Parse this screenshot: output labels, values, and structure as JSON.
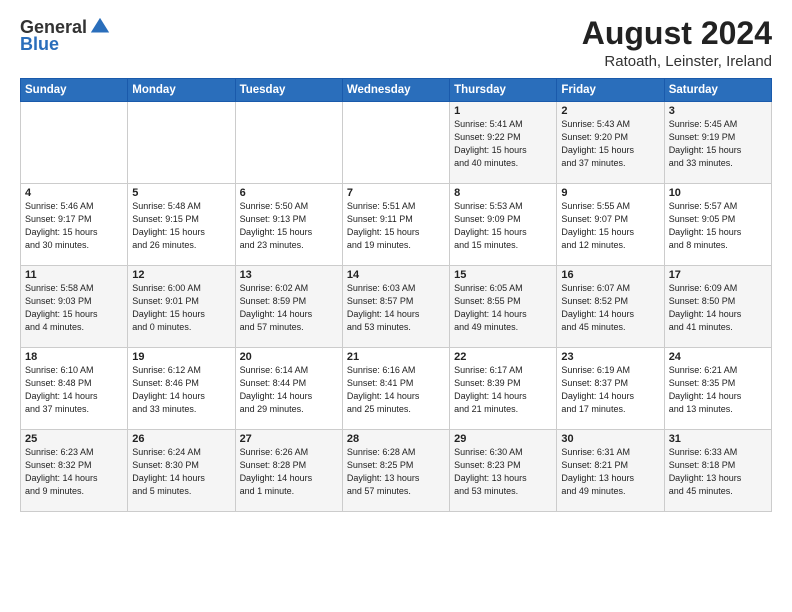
{
  "logo": {
    "general": "General",
    "blue": "Blue"
  },
  "title": "August 2024",
  "subtitle": "Ratoath, Leinster, Ireland",
  "weekdays": [
    "Sunday",
    "Monday",
    "Tuesday",
    "Wednesday",
    "Thursday",
    "Friday",
    "Saturday"
  ],
  "weeks": [
    [
      {
        "day": "",
        "info": ""
      },
      {
        "day": "",
        "info": ""
      },
      {
        "day": "",
        "info": ""
      },
      {
        "day": "",
        "info": ""
      },
      {
        "day": "1",
        "info": "Sunrise: 5:41 AM\nSunset: 9:22 PM\nDaylight: 15 hours\nand 40 minutes."
      },
      {
        "day": "2",
        "info": "Sunrise: 5:43 AM\nSunset: 9:20 PM\nDaylight: 15 hours\nand 37 minutes."
      },
      {
        "day": "3",
        "info": "Sunrise: 5:45 AM\nSunset: 9:19 PM\nDaylight: 15 hours\nand 33 minutes."
      }
    ],
    [
      {
        "day": "4",
        "info": "Sunrise: 5:46 AM\nSunset: 9:17 PM\nDaylight: 15 hours\nand 30 minutes."
      },
      {
        "day": "5",
        "info": "Sunrise: 5:48 AM\nSunset: 9:15 PM\nDaylight: 15 hours\nand 26 minutes."
      },
      {
        "day": "6",
        "info": "Sunrise: 5:50 AM\nSunset: 9:13 PM\nDaylight: 15 hours\nand 23 minutes."
      },
      {
        "day": "7",
        "info": "Sunrise: 5:51 AM\nSunset: 9:11 PM\nDaylight: 15 hours\nand 19 minutes."
      },
      {
        "day": "8",
        "info": "Sunrise: 5:53 AM\nSunset: 9:09 PM\nDaylight: 15 hours\nand 15 minutes."
      },
      {
        "day": "9",
        "info": "Sunrise: 5:55 AM\nSunset: 9:07 PM\nDaylight: 15 hours\nand 12 minutes."
      },
      {
        "day": "10",
        "info": "Sunrise: 5:57 AM\nSunset: 9:05 PM\nDaylight: 15 hours\nand 8 minutes."
      }
    ],
    [
      {
        "day": "11",
        "info": "Sunrise: 5:58 AM\nSunset: 9:03 PM\nDaylight: 15 hours\nand 4 minutes."
      },
      {
        "day": "12",
        "info": "Sunrise: 6:00 AM\nSunset: 9:01 PM\nDaylight: 15 hours\nand 0 minutes."
      },
      {
        "day": "13",
        "info": "Sunrise: 6:02 AM\nSunset: 8:59 PM\nDaylight: 14 hours\nand 57 minutes."
      },
      {
        "day": "14",
        "info": "Sunrise: 6:03 AM\nSunset: 8:57 PM\nDaylight: 14 hours\nand 53 minutes."
      },
      {
        "day": "15",
        "info": "Sunrise: 6:05 AM\nSunset: 8:55 PM\nDaylight: 14 hours\nand 49 minutes."
      },
      {
        "day": "16",
        "info": "Sunrise: 6:07 AM\nSunset: 8:52 PM\nDaylight: 14 hours\nand 45 minutes."
      },
      {
        "day": "17",
        "info": "Sunrise: 6:09 AM\nSunset: 8:50 PM\nDaylight: 14 hours\nand 41 minutes."
      }
    ],
    [
      {
        "day": "18",
        "info": "Sunrise: 6:10 AM\nSunset: 8:48 PM\nDaylight: 14 hours\nand 37 minutes."
      },
      {
        "day": "19",
        "info": "Sunrise: 6:12 AM\nSunset: 8:46 PM\nDaylight: 14 hours\nand 33 minutes."
      },
      {
        "day": "20",
        "info": "Sunrise: 6:14 AM\nSunset: 8:44 PM\nDaylight: 14 hours\nand 29 minutes."
      },
      {
        "day": "21",
        "info": "Sunrise: 6:16 AM\nSunset: 8:41 PM\nDaylight: 14 hours\nand 25 minutes."
      },
      {
        "day": "22",
        "info": "Sunrise: 6:17 AM\nSunset: 8:39 PM\nDaylight: 14 hours\nand 21 minutes."
      },
      {
        "day": "23",
        "info": "Sunrise: 6:19 AM\nSunset: 8:37 PM\nDaylight: 14 hours\nand 17 minutes."
      },
      {
        "day": "24",
        "info": "Sunrise: 6:21 AM\nSunset: 8:35 PM\nDaylight: 14 hours\nand 13 minutes."
      }
    ],
    [
      {
        "day": "25",
        "info": "Sunrise: 6:23 AM\nSunset: 8:32 PM\nDaylight: 14 hours\nand 9 minutes."
      },
      {
        "day": "26",
        "info": "Sunrise: 6:24 AM\nSunset: 8:30 PM\nDaylight: 14 hours\nand 5 minutes."
      },
      {
        "day": "27",
        "info": "Sunrise: 6:26 AM\nSunset: 8:28 PM\nDaylight: 14 hours\nand 1 minute."
      },
      {
        "day": "28",
        "info": "Sunrise: 6:28 AM\nSunset: 8:25 PM\nDaylight: 13 hours\nand 57 minutes."
      },
      {
        "day": "29",
        "info": "Sunrise: 6:30 AM\nSunset: 8:23 PM\nDaylight: 13 hours\nand 53 minutes."
      },
      {
        "day": "30",
        "info": "Sunrise: 6:31 AM\nSunset: 8:21 PM\nDaylight: 13 hours\nand 49 minutes."
      },
      {
        "day": "31",
        "info": "Sunrise: 6:33 AM\nSunset: 8:18 PM\nDaylight: 13 hours\nand 45 minutes."
      }
    ]
  ]
}
